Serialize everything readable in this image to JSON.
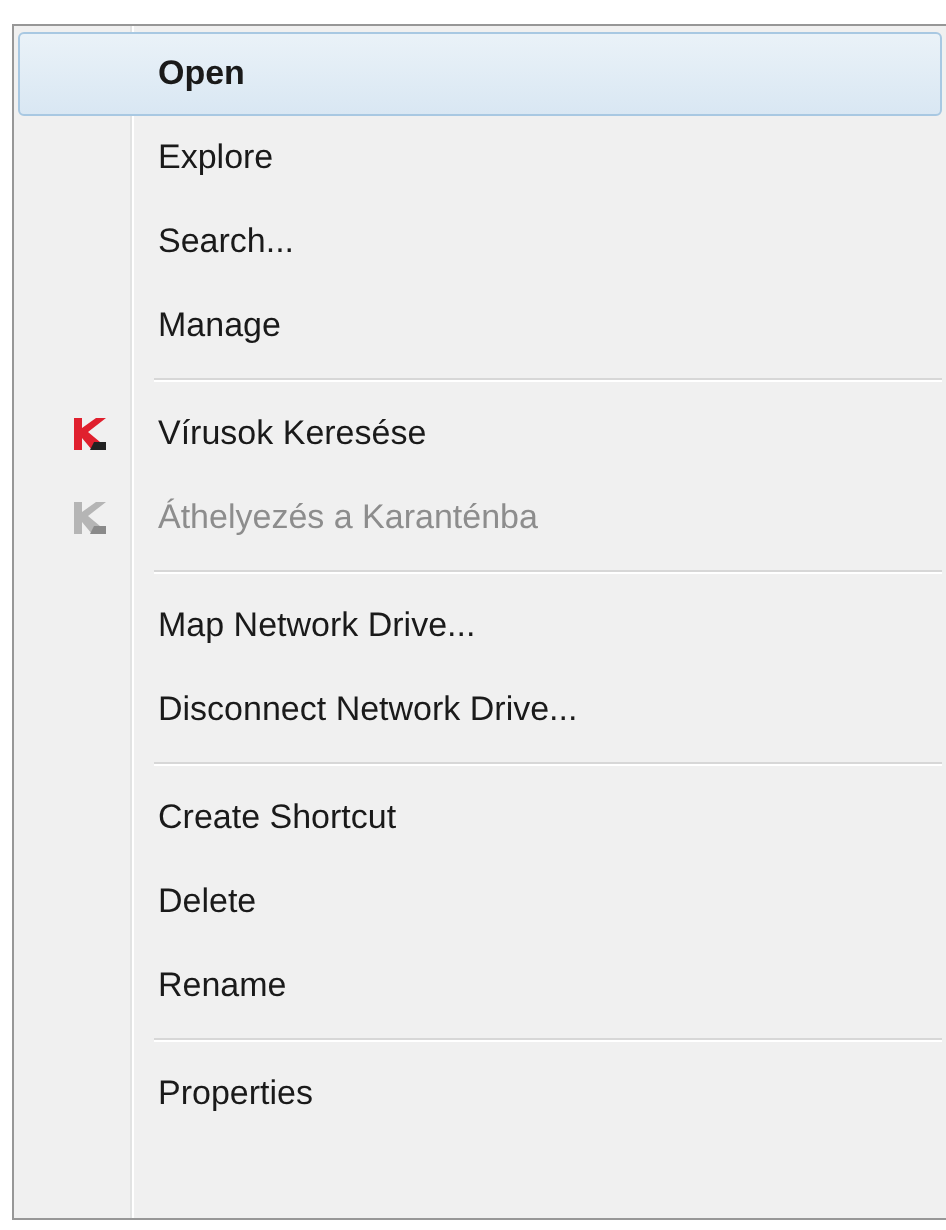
{
  "menu": {
    "items": [
      {
        "kind": "item",
        "label": "Open",
        "default": true,
        "selected": true,
        "disabled": false
      },
      {
        "kind": "item",
        "label": "Explore",
        "default": false,
        "selected": false,
        "disabled": false
      },
      {
        "kind": "item",
        "label": "Search...",
        "default": false,
        "selected": false,
        "disabled": false
      },
      {
        "kind": "item",
        "label": "Manage",
        "default": false,
        "selected": false,
        "disabled": false
      },
      {
        "kind": "separator"
      },
      {
        "kind": "icon_item",
        "label": "Vírusok Keresése",
        "default": false,
        "selected": false,
        "disabled": false
      },
      {
        "kind": "icon_item",
        "label": "Áthelyezés a Karanténba",
        "default": false,
        "selected": false,
        "disabled": true
      },
      {
        "kind": "separator"
      },
      {
        "kind": "item",
        "label": "Map Network Drive...",
        "default": false,
        "selected": false,
        "disabled": false
      },
      {
        "kind": "item",
        "label": "Disconnect Network Drive...",
        "default": false,
        "selected": false,
        "disabled": false
      },
      {
        "kind": "separator"
      },
      {
        "kind": "item",
        "label": "Create Shortcut",
        "default": false,
        "selected": false,
        "disabled": false
      },
      {
        "kind": "item",
        "label": "Delete",
        "default": false,
        "selected": false,
        "disabled": false
      },
      {
        "kind": "item",
        "label": "Rename",
        "default": false,
        "selected": false,
        "disabled": false
      },
      {
        "kind": "separator"
      },
      {
        "kind": "item",
        "label": "Properties",
        "default": false,
        "selected": false,
        "disabled": false
      }
    ]
  }
}
